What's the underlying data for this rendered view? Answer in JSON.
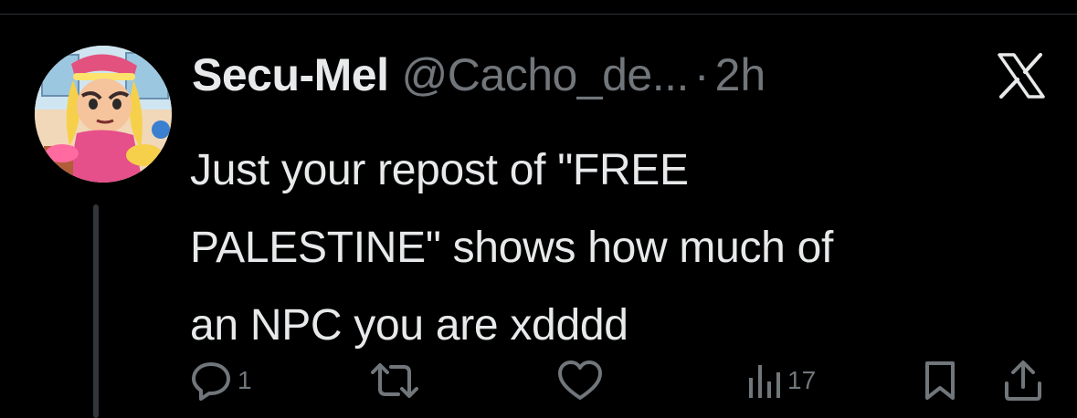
{
  "post": {
    "author": {
      "display_name": "Secu-Mel",
      "handle": "@Cacho_de...",
      "separator": "·",
      "time": "2h"
    },
    "text": "Just your repost of \"FREE\nPALESTINE\" shows how much of\nan NPC you are xdddd",
    "platform_icon": "x-logo-icon",
    "actions": {
      "reply": {
        "icon": "reply-icon",
        "count": "1"
      },
      "repost": {
        "icon": "repost-icon",
        "count": ""
      },
      "like": {
        "icon": "heart-icon",
        "count": ""
      },
      "views": {
        "icon": "views-icon",
        "count": "17"
      },
      "bookmark": {
        "icon": "bookmark-icon"
      },
      "share": {
        "icon": "share-icon"
      }
    }
  },
  "colors": {
    "background": "#000000",
    "primary_text": "#e7e9ea",
    "secondary_text": "#71767b",
    "divider": "#2f3336",
    "thread_line": "#333639"
  }
}
